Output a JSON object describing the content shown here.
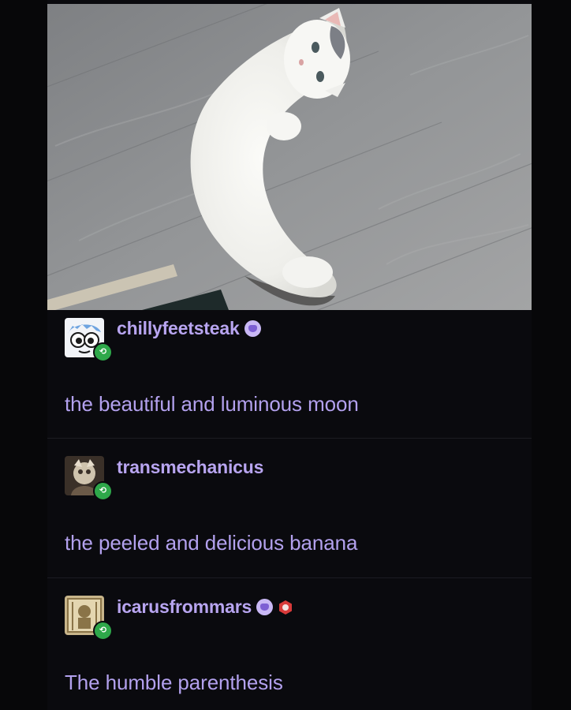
{
  "colors": {
    "background": "#070709",
    "username": "#b8a5f0",
    "comment": "#b3a1ee",
    "reblog_badge": "#2ea84a"
  },
  "image": {
    "subject": "white cat curled into a crescent on a gray wood floor"
  },
  "reblogs": [
    {
      "username": "chillyfeetsteak",
      "badges": [
        "purple-cat-badge-icon"
      ],
      "comment": "the beautiful and luminous moon"
    },
    {
      "username": "transmechanicus",
      "badges": [],
      "comment": "the peeled and delicious banana"
    },
    {
      "username": "icarusfrommars",
      "badges": [
        "purple-cat-badge-icon",
        "red-hexagon-badge-icon"
      ],
      "comment": "The humble parenthesis"
    }
  ]
}
